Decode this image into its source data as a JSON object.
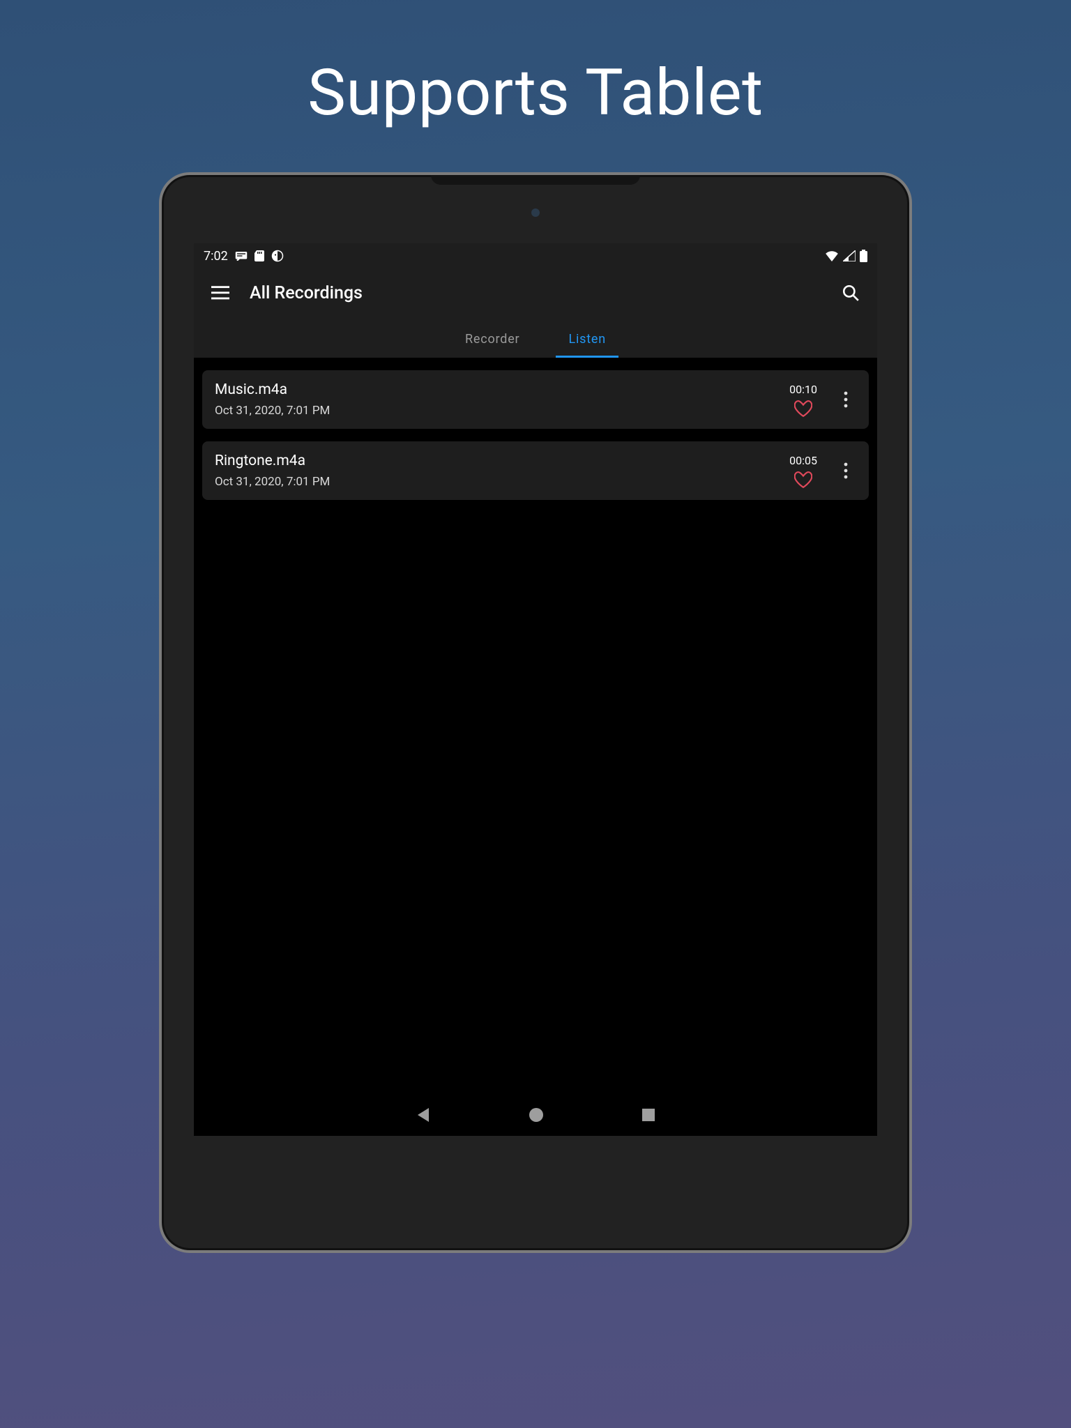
{
  "promo": {
    "title": "Supports Tablet"
  },
  "status_bar": {
    "time": "7:02"
  },
  "app_bar": {
    "title": "All Recordings"
  },
  "tabs": [
    {
      "label": "Recorder",
      "active": false
    },
    {
      "label": "Listen",
      "active": true
    }
  ],
  "recordings": [
    {
      "name": "Music.m4a",
      "date": "Oct 31, 2020, 7:01 PM",
      "duration": "00:10"
    },
    {
      "name": "Ringtone.m4a",
      "date": "Oct 31, 2020, 7:01 PM",
      "duration": "00:05"
    }
  ]
}
